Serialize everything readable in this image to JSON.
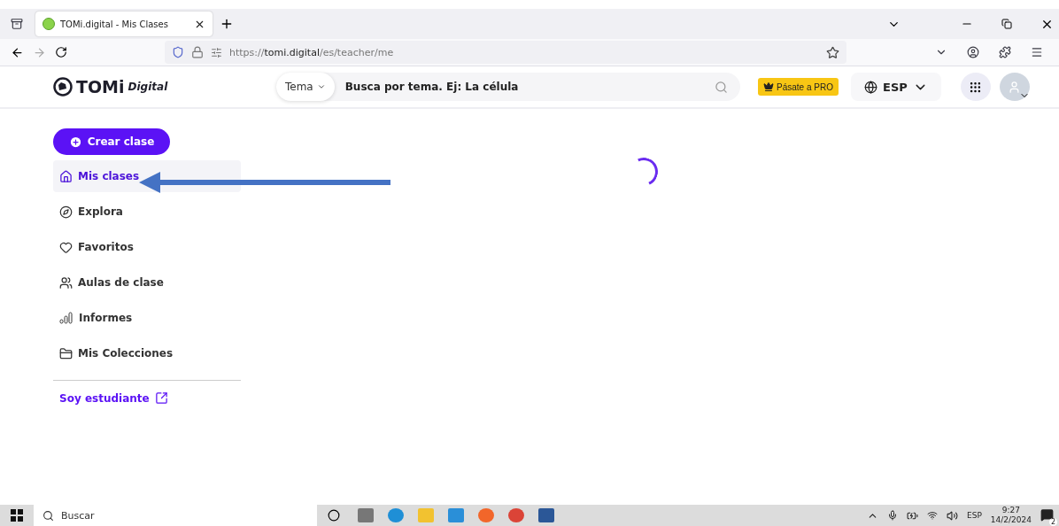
{
  "browser": {
    "tab": {
      "title": "TOMi.digital - Mis Clases",
      "selected": true
    },
    "address": {
      "scheme": "https://",
      "host": "tomi.digital",
      "path": "/es/teacher/me"
    }
  },
  "header": {
    "logo": {
      "brand": "TOMi",
      "suffix": "Digital"
    },
    "topic_select": "Tema",
    "search": {
      "placeholder": "Busca por tema. Ej: La célula"
    },
    "pro_button": "Pásate a PRO",
    "language": "ESP"
  },
  "sidebar": {
    "create_button": "Crear clase",
    "items": [
      {
        "label": "Mis clases",
        "selected": true
      },
      {
        "label": "Explora",
        "selected": false
      },
      {
        "label": "Favoritos",
        "selected": false
      },
      {
        "label": "Aulas de clase",
        "selected": false
      },
      {
        "label": "Informes",
        "selected": false
      },
      {
        "label": "Mis Colecciones",
        "selected": false
      }
    ],
    "student_link": "Soy estudiante"
  },
  "taskbar": {
    "search_placeholder": "Buscar",
    "language": "ESP",
    "time": "9:27",
    "date": "14/2/2024",
    "notifications": "2"
  }
}
